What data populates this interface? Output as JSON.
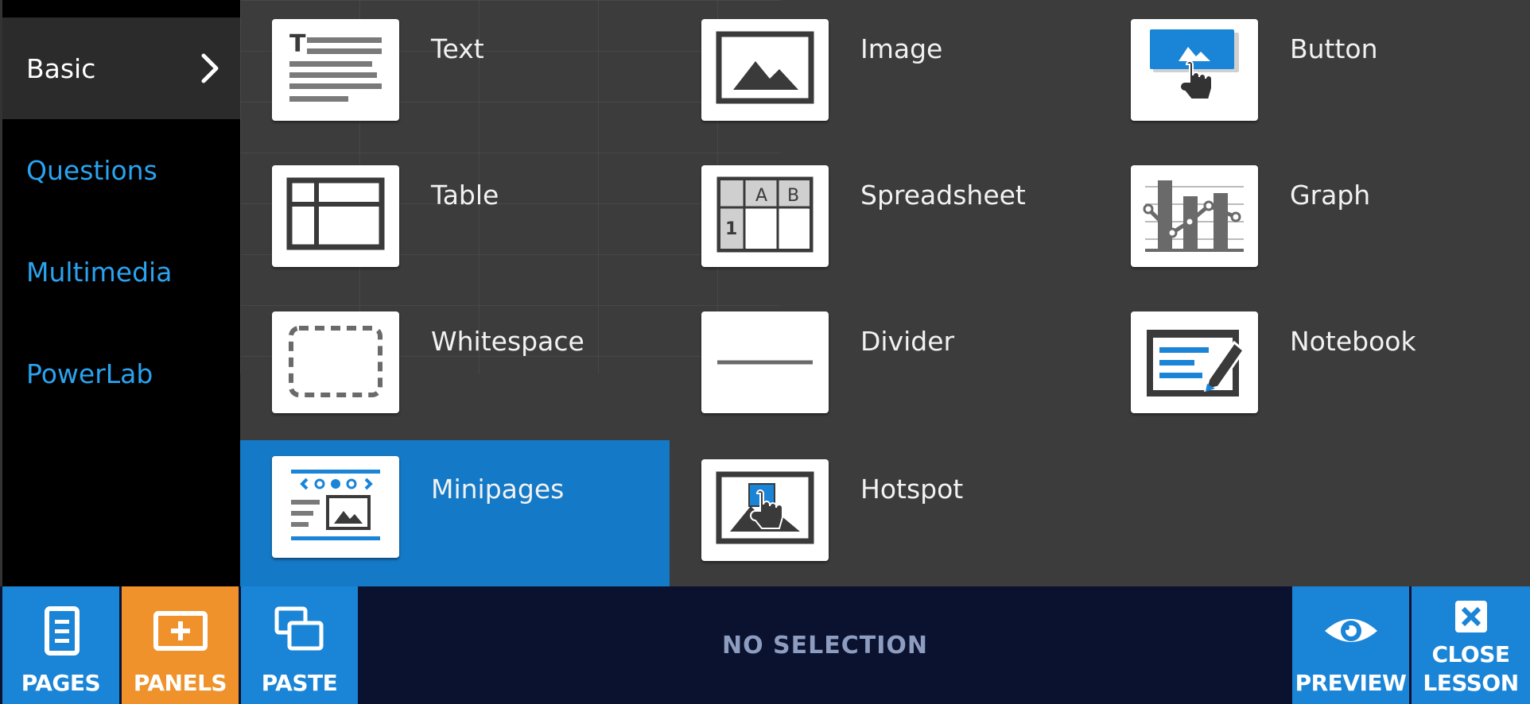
{
  "sidebar": {
    "items": [
      {
        "label": "Basic",
        "active": true
      },
      {
        "label": "Questions",
        "active": false
      },
      {
        "label": "Multimedia",
        "active": false
      },
      {
        "label": "PowerLab",
        "active": false
      }
    ]
  },
  "panels": {
    "items": [
      {
        "label": "Text",
        "icon": "text-panel-icon"
      },
      {
        "label": "Image",
        "icon": "image-panel-icon"
      },
      {
        "label": "Button",
        "icon": "button-panel-icon"
      },
      {
        "label": "Table",
        "icon": "table-panel-icon"
      },
      {
        "label": "Spreadsheet",
        "icon": "spreadsheet-panel-icon",
        "cells": [
          "A",
          "B",
          "1"
        ]
      },
      {
        "label": "Graph",
        "icon": "graph-panel-icon"
      },
      {
        "label": "Whitespace",
        "icon": "whitespace-panel-icon"
      },
      {
        "label": "Divider",
        "icon": "divider-panel-icon"
      },
      {
        "label": "Notebook",
        "icon": "notebook-panel-icon"
      },
      {
        "label": "Minipages",
        "icon": "minipages-panel-icon",
        "selected": true
      },
      {
        "label": "Hotspot",
        "icon": "hotspot-panel-icon"
      }
    ]
  },
  "toolbar": {
    "pages_label": "PAGES",
    "panels_label": "PANELS",
    "paste_label": "PASTE",
    "status": "NO SELECTION",
    "preview_label": "PREVIEW",
    "close_label_line1": "CLOSE",
    "close_label_line2": "LESSON"
  },
  "colors": {
    "accent_blue": "#1a84d7",
    "link_blue": "#2aa3f0",
    "selected_blue": "#1479c6",
    "panels_orange": "#ef922b",
    "toolbar_bg": "#0a1230",
    "panel_bg": "#3c3c3c"
  }
}
